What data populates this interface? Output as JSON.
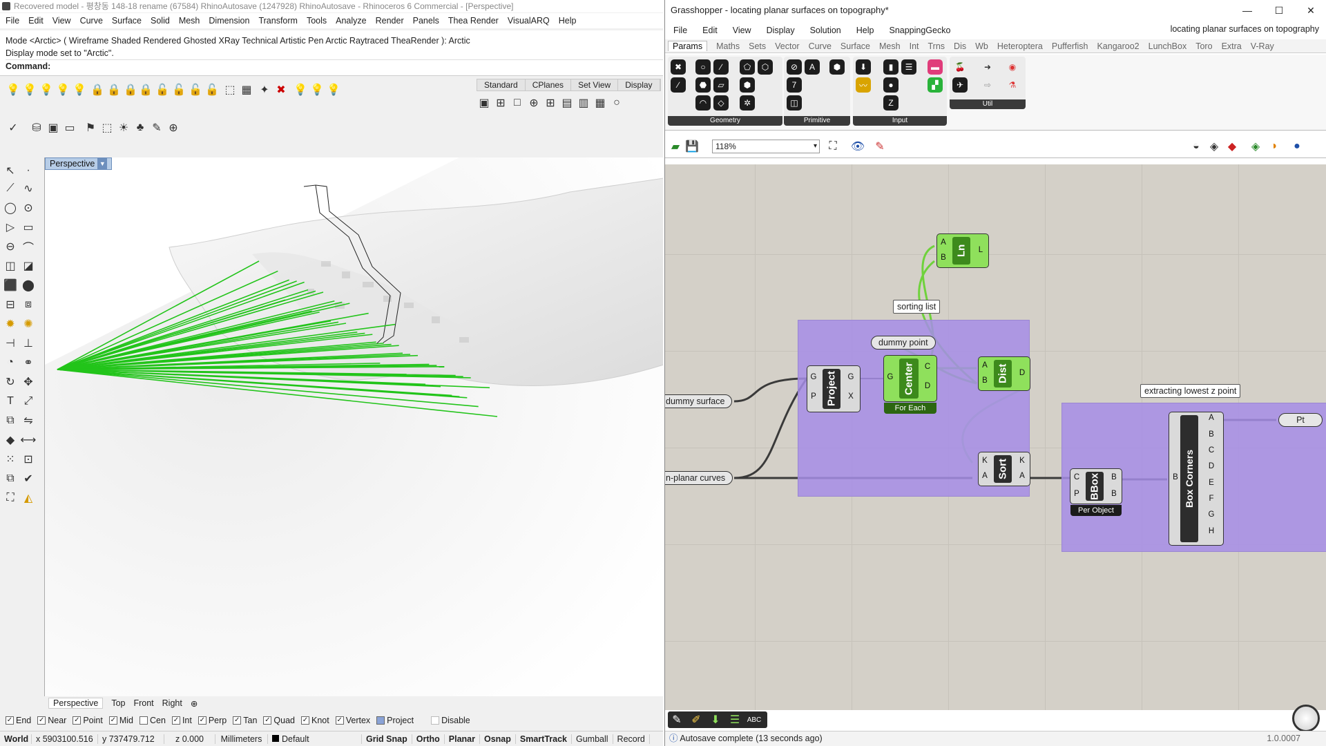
{
  "rhino": {
    "title": "Recovered model - 평창동 148-18 rename (67584) RhinoAutosave (1247928) RhinoAutosave - Rhinoceros 6 Commercial - [Perspective]",
    "menu": [
      "File",
      "Edit",
      "View",
      "Curve",
      "Surface",
      "Solid",
      "Mesh",
      "Dimension",
      "Transform",
      "Tools",
      "Analyze",
      "Render",
      "Panels",
      "Thea Render",
      "VisualARQ",
      "Help"
    ],
    "command_history": [
      "Mode <Arctic> ( Wireframe  Shaded  Rendered  Ghosted  XRay  Technical  Artistic  Pen  Arctic  Raytraced  TheaRender ): Arctic",
      "Display mode set to \"Arctic\"."
    ],
    "command_prompt": "Command:",
    "toolbar_tabs": [
      "Standard",
      "CPlanes",
      "Set View",
      "Display"
    ],
    "viewport_label": "Perspective",
    "viewport_tabs": [
      "Perspective",
      "Top",
      "Front",
      "Right"
    ],
    "osnaps": [
      {
        "label": "End",
        "checked": true
      },
      {
        "label": "Near",
        "checked": true
      },
      {
        "label": "Point",
        "checked": true
      },
      {
        "label": "Mid",
        "checked": true
      },
      {
        "label": "Cen",
        "checked": false
      },
      {
        "label": "Int",
        "checked": true
      },
      {
        "label": "Perp",
        "checked": true
      },
      {
        "label": "Tan",
        "checked": true
      },
      {
        "label": "Quad",
        "checked": true
      },
      {
        "label": "Knot",
        "checked": true
      },
      {
        "label": "Vertex",
        "checked": true
      },
      {
        "label": "Project",
        "checked": true
      },
      {
        "label": "Disable",
        "checked": false
      }
    ],
    "status": {
      "cplane": "World",
      "x": "x 5903100.516",
      "y": "y 737479.712",
      "z": "z 0.000",
      "units": "Millimeters",
      "layer": "Default",
      "toggles": [
        "Grid Snap",
        "Ortho",
        "Planar",
        "Osnap",
        "SmartTrack",
        "Gumball",
        "Record"
      ]
    },
    "accent_green": "#22c41a"
  },
  "gh": {
    "title": "Grasshopper - locating planar surfaces on topography*",
    "doc_name": "locating planar surfaces on topography",
    "menu": [
      "File",
      "Edit",
      "View",
      "Display",
      "Solution",
      "Help",
      "SnappingGecko"
    ],
    "tabs": [
      "Params",
      "Maths",
      "Sets",
      "Vector",
      "Curve",
      "Surface",
      "Mesh",
      "Int",
      "Trns",
      "Dis",
      "Wb",
      "Heteroptera",
      "Pufferfish",
      "Kangaroo2",
      "LunchBox",
      "Toro",
      "Extra",
      "V-Ray"
    ],
    "ribbon_groups": [
      "Geometry",
      "Primitive",
      "Input",
      "Util"
    ],
    "zoom": "118%",
    "nodes": {
      "sorting_list_label": "sorting list",
      "dummy_point": "dummy point",
      "dummy_surface": "dummy surface",
      "planar_curves": "n-planar curves",
      "extracting_label": "extracting lowest z point",
      "pt": "Pt",
      "project": {
        "name": "Project",
        "inputs": [
          "G",
          "P"
        ],
        "outputs": [
          "G",
          "X"
        ]
      },
      "center": {
        "name": "Center",
        "inputs": [
          "G"
        ],
        "outputs": [
          "C",
          "D"
        ],
        "footer": "For Each"
      },
      "dist": {
        "name": "Dist",
        "inputs": [
          "A",
          "B"
        ],
        "outputs": [
          "D"
        ]
      },
      "ln": {
        "name": "Ln",
        "inputs": [
          "A",
          "B"
        ],
        "outputs": [
          "L"
        ]
      },
      "sort": {
        "name": "Sort",
        "inputs": [
          "K",
          "A"
        ],
        "outputs": [
          "K",
          "A"
        ]
      },
      "bbox": {
        "name": "BBox",
        "inputs": [
          "C",
          "P"
        ],
        "outputs": [
          "B",
          "B"
        ],
        "footer": "Per Object"
      },
      "boxcorners": {
        "name": "Box Corners",
        "inputs": [
          "B"
        ],
        "outputs": [
          "A",
          "B",
          "C",
          "D",
          "E",
          "F",
          "G",
          "H"
        ]
      }
    },
    "status": "Autosave complete (13 seconds ago)",
    "version": "1.0.0007",
    "group_color": "#a68de6",
    "component_green": "#8fe05c"
  }
}
